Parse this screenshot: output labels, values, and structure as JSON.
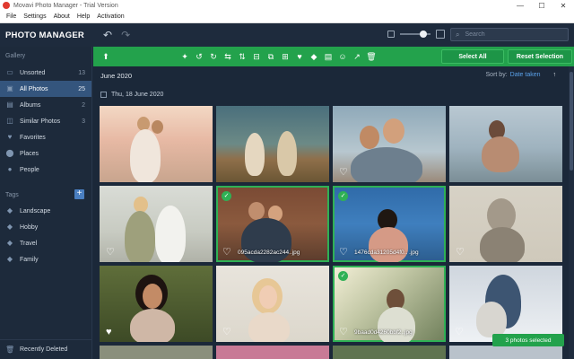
{
  "window": {
    "title": "Movavi Photo Manager - Trial Version",
    "minimize": "—",
    "maximize": "☐",
    "close": "✕"
  },
  "menu": [
    "File",
    "Settings",
    "About",
    "Help",
    "Activation"
  ],
  "brand": {
    "part1": "PHOTO",
    "part2": " MANAGER"
  },
  "search": {
    "placeholder": "Search"
  },
  "sidebar": {
    "gallery_title": "Gallery",
    "items": [
      {
        "label": "Unsorted",
        "count": "13",
        "icon": "inbox-icon",
        "glyph": "▭"
      },
      {
        "label": "All Photos",
        "count": "25",
        "icon": "photos-icon",
        "glyph": "▣"
      },
      {
        "label": "Albums",
        "count": "2",
        "icon": "albums-icon",
        "glyph": "▤"
      },
      {
        "label": "Similar Photos",
        "count": "3",
        "icon": "similar-icon",
        "glyph": "◫"
      },
      {
        "label": "Favorites",
        "count": "",
        "icon": "heart-icon",
        "glyph": "♥"
      },
      {
        "label": "Places",
        "count": "",
        "icon": "location-icon",
        "glyph": "⬤"
      },
      {
        "label": "People",
        "count": "",
        "icon": "person-icon",
        "glyph": "●"
      }
    ],
    "tags_title": "Tags",
    "tags": [
      {
        "label": "Landscape",
        "icon": "tag-icon",
        "glyph": "◆"
      },
      {
        "label": "Hobby",
        "icon": "tag-icon",
        "glyph": "◆"
      },
      {
        "label": "Travel",
        "icon": "tag-icon",
        "glyph": "◆"
      },
      {
        "label": "Family",
        "icon": "tag-icon",
        "glyph": "◆"
      }
    ],
    "recently_deleted": "Recently Deleted"
  },
  "toolbar": {
    "icons": [
      "magic-wand-icon",
      "rotate-left-icon",
      "rotate-right-icon",
      "flip-horizontal-icon",
      "flip-vertical-icon",
      "straighten-icon",
      "crop-icon",
      "resize-icon",
      "favorite-icon",
      "tag-icon",
      "album-icon",
      "face-icon",
      "share-icon",
      "delete-icon"
    ],
    "glyphs": [
      "✦",
      "↺",
      "↻",
      "⇆",
      "⇅",
      "⊟",
      "⧉",
      "⊞",
      "♥",
      "◆",
      "▤",
      "☺",
      "↗",
      "🗑"
    ],
    "select_all": "Select All",
    "reset_selection": "Reset Selection"
  },
  "content": {
    "group_date": "June 2020",
    "sort_label": "Sort by:",
    "sort_value": "Date taken",
    "sort_arrow": "↑",
    "day_label": "Thu, 18 June 2020",
    "photos": [
      {
        "filename": "",
        "selected": false,
        "heart": false
      },
      {
        "filename": "",
        "selected": false,
        "heart": false
      },
      {
        "filename": "",
        "selected": false,
        "heart": true
      },
      {
        "filename": "",
        "selected": false,
        "heart": false
      },
      {
        "filename": "",
        "selected": false,
        "heart": true
      },
      {
        "filename": "095acda2282ac244..jpg",
        "selected": true,
        "heart": true
      },
      {
        "filename": "1476cda31205d4f0.. .jpg",
        "selected": true,
        "heart": true
      },
      {
        "filename": "",
        "selected": false,
        "heart": true
      },
      {
        "filename": "",
        "selected": false,
        "heart": true
      },
      {
        "filename": "",
        "selected": false,
        "heart": true
      },
      {
        "filename": "9baad0d4260bbf2..jpg",
        "selected": true,
        "heart": true
      },
      {
        "filename": "",
        "selected": false,
        "heart": true
      }
    ],
    "selection_badge": "3 photos selected"
  },
  "colors": {
    "accent_green": "#23a24c",
    "sidebar_bg": "#1d2a3b",
    "active_blue": "#34557d",
    "link_blue": "#5aa0e8"
  }
}
